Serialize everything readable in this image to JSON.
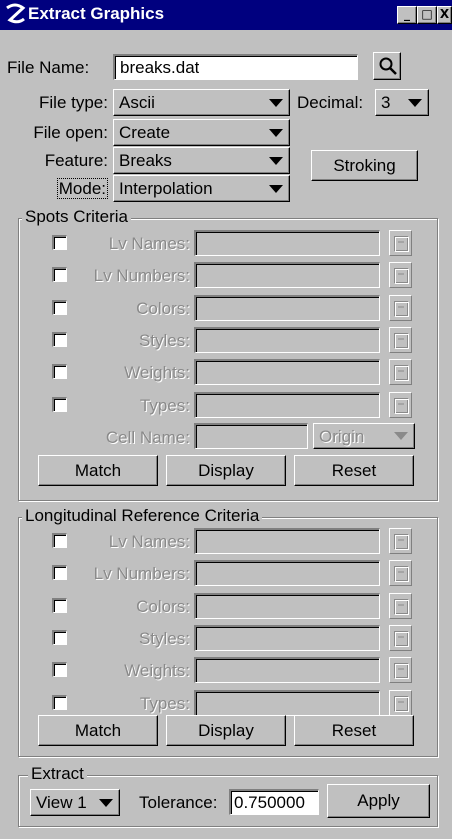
{
  "window": {
    "title": "Extract Graphics",
    "controls": [
      "_",
      "□",
      "X"
    ]
  },
  "file_name": {
    "label": "File Name:",
    "value": "breaks.dat",
    "browse_icon": "magnifier-icon"
  },
  "file_type": {
    "label": "File type:",
    "value": "Ascii"
  },
  "decimal": {
    "label": "Decimal:",
    "value": "3"
  },
  "file_open": {
    "label": "File open:",
    "value": "Create"
  },
  "feature": {
    "label": "Feature:",
    "value": "Breaks"
  },
  "stroking_button": "Stroking",
  "mode": {
    "label": "Mode:",
    "value": "Interpolation"
  },
  "spots_criteria": {
    "title": "Spots Criteria",
    "rows": [
      {
        "label": "Lv Names:"
      },
      {
        "label": "Lv Numbers:"
      },
      {
        "label": "Colors:"
      },
      {
        "label": "Styles:"
      },
      {
        "label": "Weights:"
      },
      {
        "label": "Types:"
      }
    ],
    "cell_name": {
      "label": "Cell Name:",
      "value": ""
    },
    "origin": "Origin",
    "buttons": {
      "match": "Match",
      "display": "Display",
      "reset": "Reset"
    }
  },
  "longitudinal_criteria": {
    "title": "Longitudinal Reference  Criteria",
    "rows": [
      {
        "label": "Lv Names:"
      },
      {
        "label": "Lv Numbers:"
      },
      {
        "label": "Colors:"
      },
      {
        "label": "Styles:"
      },
      {
        "label": "Weights:"
      },
      {
        "label": "Types:"
      }
    ],
    "buttons": {
      "match": "Match",
      "display": "Display",
      "reset": "Reset"
    }
  },
  "extract": {
    "title": "Extract",
    "view": "View 1",
    "tolerance_label": "Tolerance:",
    "tolerance_value": "0.750000",
    "apply": "Apply"
  },
  "colors": {
    "titlebar": "#00007f",
    "face": "#c0c0c0"
  }
}
